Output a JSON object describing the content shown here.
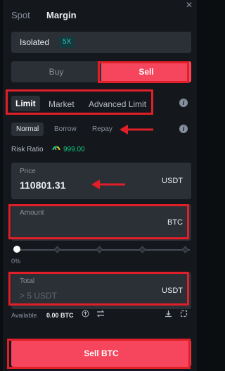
{
  "header": {
    "tabs": [
      {
        "label": "Spot",
        "active": false
      },
      {
        "label": "Margin",
        "active": true
      }
    ],
    "close_glyph": "✕"
  },
  "margin_mode": {
    "label": "Isolated",
    "leverage": "5X"
  },
  "side_toggle": {
    "buy_label": "Buy",
    "sell_label": "Sell",
    "selected": "Sell"
  },
  "order_types": [
    {
      "label": "Limit",
      "active": true
    },
    {
      "label": "Market",
      "active": false
    },
    {
      "label": "Advanced Limit",
      "active": false
    }
  ],
  "borrow_modes": [
    {
      "label": "Normal",
      "active": true
    },
    {
      "label": "Borrow",
      "active": false
    },
    {
      "label": "Repay",
      "active": false
    }
  ],
  "risk": {
    "label": "Risk Ratio",
    "value": "999.00"
  },
  "price": {
    "label": "Price",
    "value": "110801.31",
    "unit": "USDT"
  },
  "amount": {
    "label": "Amount",
    "value": "",
    "unit": "BTC"
  },
  "slider": {
    "percent_label": "0%",
    "value_fraction": 0
  },
  "total": {
    "label": "Total",
    "placeholder": "> 5 USDT",
    "unit": "USDT"
  },
  "available": {
    "label": "Available",
    "value": "0.00 BTC"
  },
  "submit": {
    "label": "Sell BTC"
  },
  "colors": {
    "sell": "#f6465d",
    "buy_text": "#8a919e",
    "accent_teal": "#2ebfb5",
    "risk_green": "#0ecb81",
    "annotation": "#e01f28"
  },
  "icons": [
    "info-icon",
    "gauge-icon",
    "convert-icon",
    "transfer-icon",
    "download-icon",
    "settings-icon",
    "close-icon"
  ]
}
